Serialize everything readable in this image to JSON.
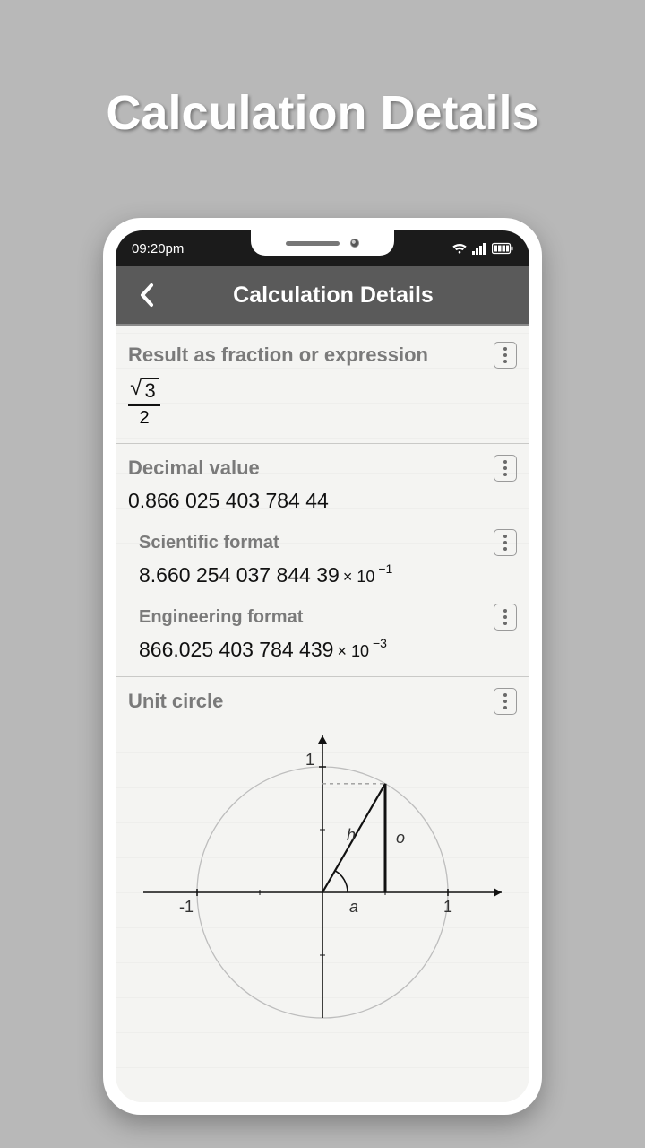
{
  "page": {
    "heading": "Calculation Details"
  },
  "statusbar": {
    "time": "09:20pm"
  },
  "header": {
    "title": "Calculation Details"
  },
  "sections": {
    "fraction": {
      "label": "Result as fraction or expression",
      "radicand": "3",
      "denominator": "2"
    },
    "decimal": {
      "label": "Decimal value",
      "value": "0.866 025 403 784 44"
    },
    "scientific": {
      "label": "Scientific format",
      "mantissa": "8.660 254 037 844 39",
      "times": "× 10",
      "exponent": "−1"
    },
    "engineering": {
      "label": "Engineering format",
      "mantissa": "866.025 403 784 439",
      "times": "× 10",
      "exponent": "−3"
    },
    "unitcircle": {
      "label": "Unit circle",
      "axis_labels": {
        "y_top": "1",
        "x_left": "-1",
        "x_right": "1"
      },
      "side_labels": {
        "hyp": "h",
        "opp": "o",
        "adj": "a"
      }
    }
  }
}
